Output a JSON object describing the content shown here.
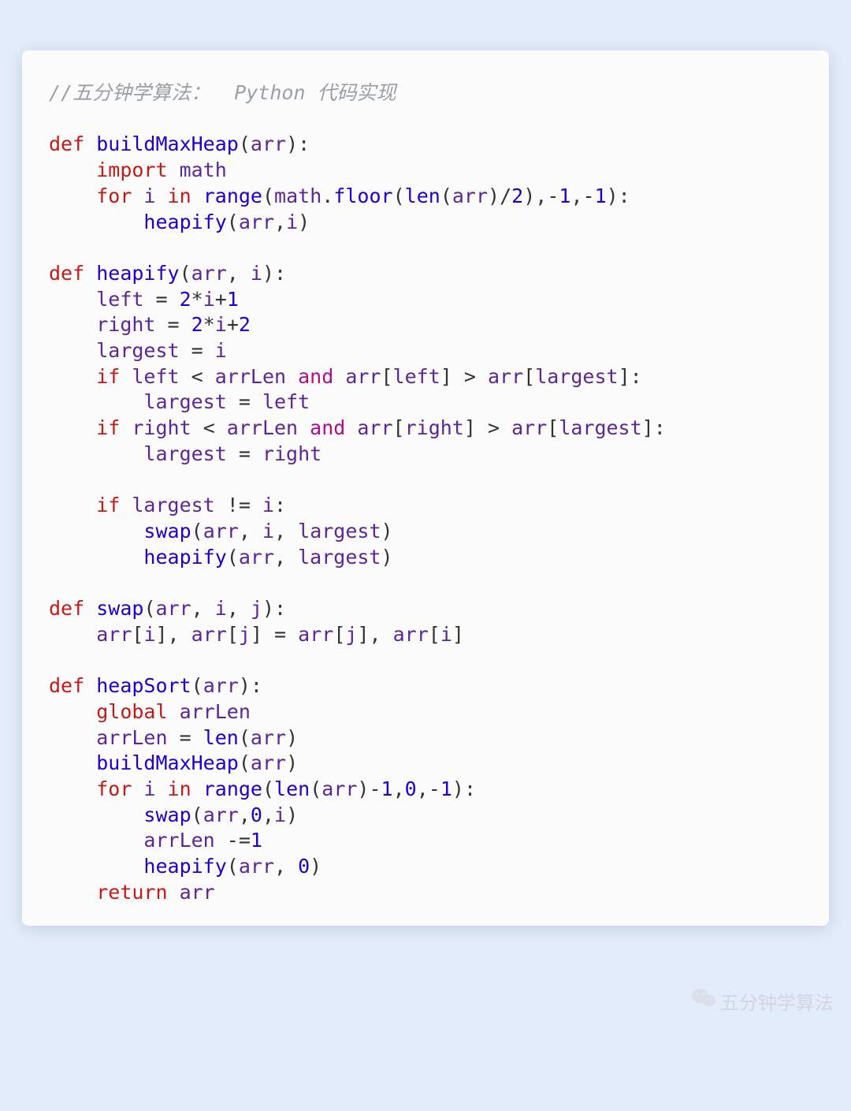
{
  "comment": "//五分钟学算法：  Python 代码实现",
  "watermark": {
    "label": "五分钟学算法"
  },
  "code": {
    "lines": [
      {
        "indent": 0,
        "t": [
          [
            "kw",
            "def "
          ],
          [
            "fn",
            "buildMaxHeap"
          ],
          [
            "punc",
            "("
          ],
          [
            "iden",
            "arr"
          ],
          [
            "punc",
            "):"
          ]
        ]
      },
      {
        "indent": 1,
        "t": [
          [
            "kw",
            "import "
          ],
          [
            "iden",
            "math"
          ]
        ]
      },
      {
        "indent": 1,
        "t": [
          [
            "kw",
            "for "
          ],
          [
            "iden",
            "i"
          ],
          [
            "kw",
            " in "
          ],
          [
            "fn",
            "range"
          ],
          [
            "punc",
            "("
          ],
          [
            "iden",
            "math"
          ],
          [
            "punc",
            "."
          ],
          [
            "fn",
            "floor"
          ],
          [
            "punc",
            "("
          ],
          [
            "fn",
            "len"
          ],
          [
            "punc",
            "("
          ],
          [
            "iden",
            "arr"
          ],
          [
            "punc",
            ")/"
          ],
          [
            "num",
            "2"
          ],
          [
            "punc",
            "),"
          ],
          [
            "op",
            "-"
          ],
          [
            "num",
            "1"
          ],
          [
            "punc",
            ","
          ],
          [
            "op",
            "-"
          ],
          [
            "num",
            "1"
          ],
          [
            "punc",
            "):"
          ]
        ]
      },
      {
        "indent": 2,
        "t": [
          [
            "fn",
            "heapify"
          ],
          [
            "punc",
            "("
          ],
          [
            "iden",
            "arr"
          ],
          [
            "punc",
            ","
          ],
          [
            "iden",
            "i"
          ],
          [
            "punc",
            ")"
          ]
        ]
      },
      {
        "blank": true
      },
      {
        "indent": 0,
        "t": [
          [
            "kw",
            "def "
          ],
          [
            "fn",
            "heapify"
          ],
          [
            "punc",
            "("
          ],
          [
            "iden",
            "arr"
          ],
          [
            "punc",
            ", "
          ],
          [
            "iden",
            "i"
          ],
          [
            "punc",
            "):"
          ]
        ]
      },
      {
        "indent": 1,
        "t": [
          [
            "iden",
            "left"
          ],
          [
            "op",
            " = "
          ],
          [
            "num",
            "2"
          ],
          [
            "op",
            "*"
          ],
          [
            "iden",
            "i"
          ],
          [
            "op",
            "+"
          ],
          [
            "num",
            "1"
          ]
        ]
      },
      {
        "indent": 1,
        "t": [
          [
            "iden",
            "right"
          ],
          [
            "op",
            " = "
          ],
          [
            "num",
            "2"
          ],
          [
            "op",
            "*"
          ],
          [
            "iden",
            "i"
          ],
          [
            "op",
            "+"
          ],
          [
            "num",
            "2"
          ]
        ]
      },
      {
        "indent": 1,
        "t": [
          [
            "iden",
            "largest"
          ],
          [
            "op",
            " = "
          ],
          [
            "iden",
            "i"
          ]
        ]
      },
      {
        "indent": 1,
        "t": [
          [
            "kw",
            "if "
          ],
          [
            "iden",
            "left"
          ],
          [
            "op",
            " < "
          ],
          [
            "iden",
            "arrLen"
          ],
          [
            "and",
            " and "
          ],
          [
            "iden",
            "arr"
          ],
          [
            "punc",
            "["
          ],
          [
            "iden",
            "left"
          ],
          [
            "punc",
            "]"
          ],
          [
            "op",
            " > "
          ],
          [
            "iden",
            "arr"
          ],
          [
            "punc",
            "["
          ],
          [
            "iden",
            "largest"
          ],
          [
            "punc",
            "]:"
          ]
        ]
      },
      {
        "indent": 2,
        "t": [
          [
            "iden",
            "largest"
          ],
          [
            "op",
            " = "
          ],
          [
            "iden",
            "left"
          ]
        ]
      },
      {
        "indent": 1,
        "t": [
          [
            "kw",
            "if "
          ],
          [
            "iden",
            "right"
          ],
          [
            "op",
            " < "
          ],
          [
            "iden",
            "arrLen"
          ],
          [
            "and",
            " and "
          ],
          [
            "iden",
            "arr"
          ],
          [
            "punc",
            "["
          ],
          [
            "iden",
            "right"
          ],
          [
            "punc",
            "]"
          ],
          [
            "op",
            " > "
          ],
          [
            "iden",
            "arr"
          ],
          [
            "punc",
            "["
          ],
          [
            "iden",
            "largest"
          ],
          [
            "punc",
            "]:"
          ]
        ]
      },
      {
        "indent": 2,
        "t": [
          [
            "iden",
            "largest"
          ],
          [
            "op",
            " = "
          ],
          [
            "iden",
            "right"
          ]
        ]
      },
      {
        "blank": true
      },
      {
        "indent": 1,
        "t": [
          [
            "kw",
            "if "
          ],
          [
            "iden",
            "largest"
          ],
          [
            "op",
            " != "
          ],
          [
            "iden",
            "i"
          ],
          [
            "punc",
            ":"
          ]
        ]
      },
      {
        "indent": 2,
        "t": [
          [
            "fn",
            "swap"
          ],
          [
            "punc",
            "("
          ],
          [
            "iden",
            "arr"
          ],
          [
            "punc",
            ", "
          ],
          [
            "iden",
            "i"
          ],
          [
            "punc",
            ", "
          ],
          [
            "iden",
            "largest"
          ],
          [
            "punc",
            ")"
          ]
        ]
      },
      {
        "indent": 2,
        "t": [
          [
            "fn",
            "heapify"
          ],
          [
            "punc",
            "("
          ],
          [
            "iden",
            "arr"
          ],
          [
            "punc",
            ", "
          ],
          [
            "iden",
            "largest"
          ],
          [
            "punc",
            ")"
          ]
        ]
      },
      {
        "blank": true
      },
      {
        "indent": 0,
        "t": [
          [
            "kw",
            "def "
          ],
          [
            "fn",
            "swap"
          ],
          [
            "punc",
            "("
          ],
          [
            "iden",
            "arr"
          ],
          [
            "punc",
            ", "
          ],
          [
            "iden",
            "i"
          ],
          [
            "punc",
            ", "
          ],
          [
            "iden",
            "j"
          ],
          [
            "punc",
            "):"
          ]
        ]
      },
      {
        "indent": 1,
        "t": [
          [
            "iden",
            "arr"
          ],
          [
            "punc",
            "["
          ],
          [
            "iden",
            "i"
          ],
          [
            "punc",
            "], "
          ],
          [
            "iden",
            "arr"
          ],
          [
            "punc",
            "["
          ],
          [
            "iden",
            "j"
          ],
          [
            "punc",
            "]"
          ],
          [
            "op",
            " = "
          ],
          [
            "iden",
            "arr"
          ],
          [
            "punc",
            "["
          ],
          [
            "iden",
            "j"
          ],
          [
            "punc",
            "], "
          ],
          [
            "iden",
            "arr"
          ],
          [
            "punc",
            "["
          ],
          [
            "iden",
            "i"
          ],
          [
            "punc",
            "]"
          ]
        ]
      },
      {
        "blank": true
      },
      {
        "indent": 0,
        "t": [
          [
            "kw",
            "def "
          ],
          [
            "fn",
            "heapSort"
          ],
          [
            "punc",
            "("
          ],
          [
            "iden",
            "arr"
          ],
          [
            "punc",
            "):"
          ]
        ]
      },
      {
        "indent": 1,
        "t": [
          [
            "kw",
            "global "
          ],
          [
            "iden",
            "arrLen"
          ]
        ]
      },
      {
        "indent": 1,
        "t": [
          [
            "iden",
            "arrLen"
          ],
          [
            "op",
            " = "
          ],
          [
            "fn",
            "len"
          ],
          [
            "punc",
            "("
          ],
          [
            "iden",
            "arr"
          ],
          [
            "punc",
            ")"
          ]
        ]
      },
      {
        "indent": 1,
        "t": [
          [
            "fn",
            "buildMaxHeap"
          ],
          [
            "punc",
            "("
          ],
          [
            "iden",
            "arr"
          ],
          [
            "punc",
            ")"
          ]
        ]
      },
      {
        "indent": 1,
        "t": [
          [
            "kw",
            "for "
          ],
          [
            "iden",
            "i"
          ],
          [
            "kw",
            " in "
          ],
          [
            "fn",
            "range"
          ],
          [
            "punc",
            "("
          ],
          [
            "fn",
            "len"
          ],
          [
            "punc",
            "("
          ],
          [
            "iden",
            "arr"
          ],
          [
            "punc",
            ")"
          ],
          [
            "op",
            "-"
          ],
          [
            "num",
            "1"
          ],
          [
            "punc",
            ","
          ],
          [
            "num",
            "0"
          ],
          [
            "punc",
            ","
          ],
          [
            "op",
            "-"
          ],
          [
            "num",
            "1"
          ],
          [
            "punc",
            "):"
          ]
        ]
      },
      {
        "indent": 2,
        "t": [
          [
            "fn",
            "swap"
          ],
          [
            "punc",
            "("
          ],
          [
            "iden",
            "arr"
          ],
          [
            "punc",
            ","
          ],
          [
            "num",
            "0"
          ],
          [
            "punc",
            ","
          ],
          [
            "iden",
            "i"
          ],
          [
            "punc",
            ")"
          ]
        ]
      },
      {
        "indent": 2,
        "t": [
          [
            "iden",
            "arrLen"
          ],
          [
            "op",
            " -="
          ],
          [
            "num",
            "1"
          ]
        ]
      },
      {
        "indent": 2,
        "t": [
          [
            "fn",
            "heapify"
          ],
          [
            "punc",
            "("
          ],
          [
            "iden",
            "arr"
          ],
          [
            "punc",
            ", "
          ],
          [
            "num",
            "0"
          ],
          [
            "punc",
            ")"
          ]
        ]
      },
      {
        "indent": 1,
        "t": [
          [
            "kw",
            "return "
          ],
          [
            "iden",
            "arr"
          ]
        ]
      }
    ]
  },
  "syntax_classes": {
    "kw": "c-kw",
    "fn": "c-fn",
    "iden": "c-iden",
    "op": "c-op",
    "num": "c-num",
    "and": "c-and",
    "punc": "c-punc"
  }
}
